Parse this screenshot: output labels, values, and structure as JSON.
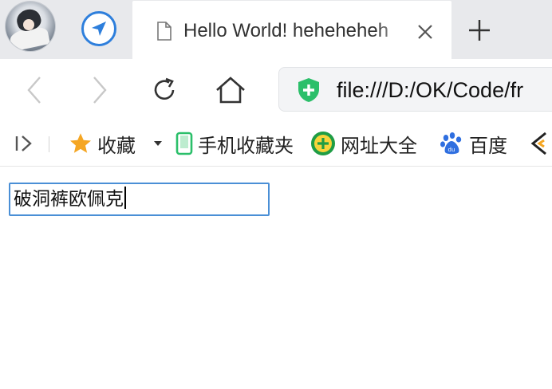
{
  "tab": {
    "title": "Hello World! heheheheh"
  },
  "toolbar": {
    "url": "file:///D:/OK/Code/fr"
  },
  "bookmarks": {
    "items": [
      {
        "label": "收藏",
        "icon": "star-icon"
      },
      {
        "label": "手机收藏夹",
        "icon": "phone-icon"
      },
      {
        "label": "网址大全",
        "icon": "url-navigation-icon"
      },
      {
        "label": "百度",
        "icon": "baidu-paw-icon"
      }
    ]
  },
  "page": {
    "input_value": "破洞裤欧佩克"
  },
  "colors": {
    "accent": "#2e7fdc",
    "input_border": "#4a8fd6",
    "shield": "#2bbf6a",
    "star": "#f5a623"
  }
}
